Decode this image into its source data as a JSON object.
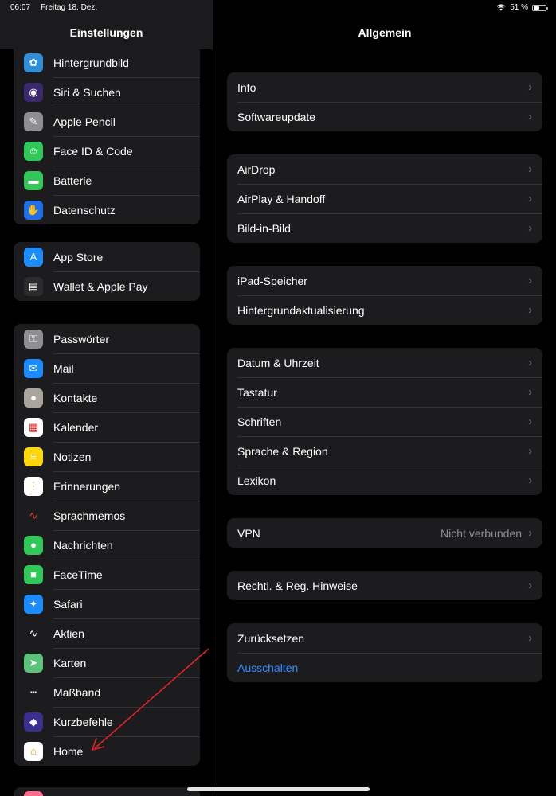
{
  "status_bar": {
    "time": "06:07",
    "date": "Freitag 18. Dez.",
    "battery_text": "51 %",
    "battery_level": 0.51
  },
  "sidebar": {
    "title": "Einstellungen",
    "groups": [
      {
        "items": [
          {
            "label": "Hintergrundbild",
            "icon": "wallpaper-icon",
            "color": "#2f8fd9"
          },
          {
            "label": "Siri & Suchen",
            "icon": "siri-icon",
            "color": "#3b2a6b"
          },
          {
            "label": "Apple Pencil",
            "icon": "pencil-icon",
            "color": "#8e8e93"
          },
          {
            "label": "Face ID & Code",
            "icon": "faceid-icon",
            "color": "#32c759"
          },
          {
            "label": "Batterie",
            "icon": "battery-icon",
            "color": "#32c759"
          },
          {
            "label": "Datenschutz",
            "icon": "hand-icon",
            "color": "#1e6fe8"
          }
        ]
      },
      {
        "items": [
          {
            "label": "App Store",
            "icon": "appstore-icon",
            "color": "#1a8cff"
          },
          {
            "label": "Wallet & Apple Pay",
            "icon": "wallet-icon",
            "color": "#2c2c2e"
          }
        ]
      },
      {
        "items": [
          {
            "label": "Passwörter",
            "icon": "key-icon",
            "color": "#8e8e93"
          },
          {
            "label": "Mail",
            "icon": "mail-icon",
            "color": "#1a8cff"
          },
          {
            "label": "Kontakte",
            "icon": "contacts-icon",
            "color": "#a9a59c"
          },
          {
            "label": "Kalender",
            "icon": "calendar-icon",
            "color": "#ffffff"
          },
          {
            "label": "Notizen",
            "icon": "notes-icon",
            "color": "#ffd60a"
          },
          {
            "label": "Erinnerungen",
            "icon": "reminders-icon",
            "color": "#ffffff"
          },
          {
            "label": "Sprachmemos",
            "icon": "voicememo-icon",
            "color": "#1c1c1e"
          },
          {
            "label": "Nachrichten",
            "icon": "messages-icon",
            "color": "#32c759"
          },
          {
            "label": "FaceTime",
            "icon": "facetime-icon",
            "color": "#32c759"
          },
          {
            "label": "Safari",
            "icon": "safari-icon",
            "color": "#1a8cff"
          },
          {
            "label": "Aktien",
            "icon": "stocks-icon",
            "color": "#1c1c1e"
          },
          {
            "label": "Karten",
            "icon": "maps-icon",
            "color": "#5ac27a"
          },
          {
            "label": "Maßband",
            "icon": "measure-icon",
            "color": "#1c1c1e"
          },
          {
            "label": "Kurzbefehle",
            "icon": "shortcuts-icon",
            "color": "#3a2f8f"
          },
          {
            "label": "Home",
            "icon": "home-icon",
            "color": "#ffffff"
          }
        ]
      }
    ]
  },
  "main": {
    "title": "Allgemein",
    "groups": [
      {
        "rows": [
          {
            "label": "Info"
          },
          {
            "label": "Softwareupdate"
          }
        ]
      },
      {
        "rows": [
          {
            "label": "AirDrop"
          },
          {
            "label": "AirPlay & Handoff"
          },
          {
            "label": "Bild-in-Bild"
          }
        ]
      },
      {
        "rows": [
          {
            "label": "iPad-Speicher"
          },
          {
            "label": "Hintergrundaktualisierung"
          }
        ]
      },
      {
        "rows": [
          {
            "label": "Datum & Uhrzeit"
          },
          {
            "label": "Tastatur"
          },
          {
            "label": "Schriften"
          },
          {
            "label": "Sprache & Region"
          },
          {
            "label": "Lexikon"
          }
        ]
      },
      {
        "rows": [
          {
            "label": "VPN",
            "value": "Nicht verbunden"
          }
        ]
      },
      {
        "rows": [
          {
            "label": "Rechtl. & Reg. Hinweise"
          }
        ]
      },
      {
        "rows": [
          {
            "label": "Zurücksetzen"
          },
          {
            "label": "Ausschalten",
            "action": true
          }
        ]
      }
    ]
  },
  "chevron": "›",
  "colors": {
    "accent_blue": "#2f8cff",
    "annotation_red": "#e02424",
    "cell_bg": "#1c1c1e"
  }
}
